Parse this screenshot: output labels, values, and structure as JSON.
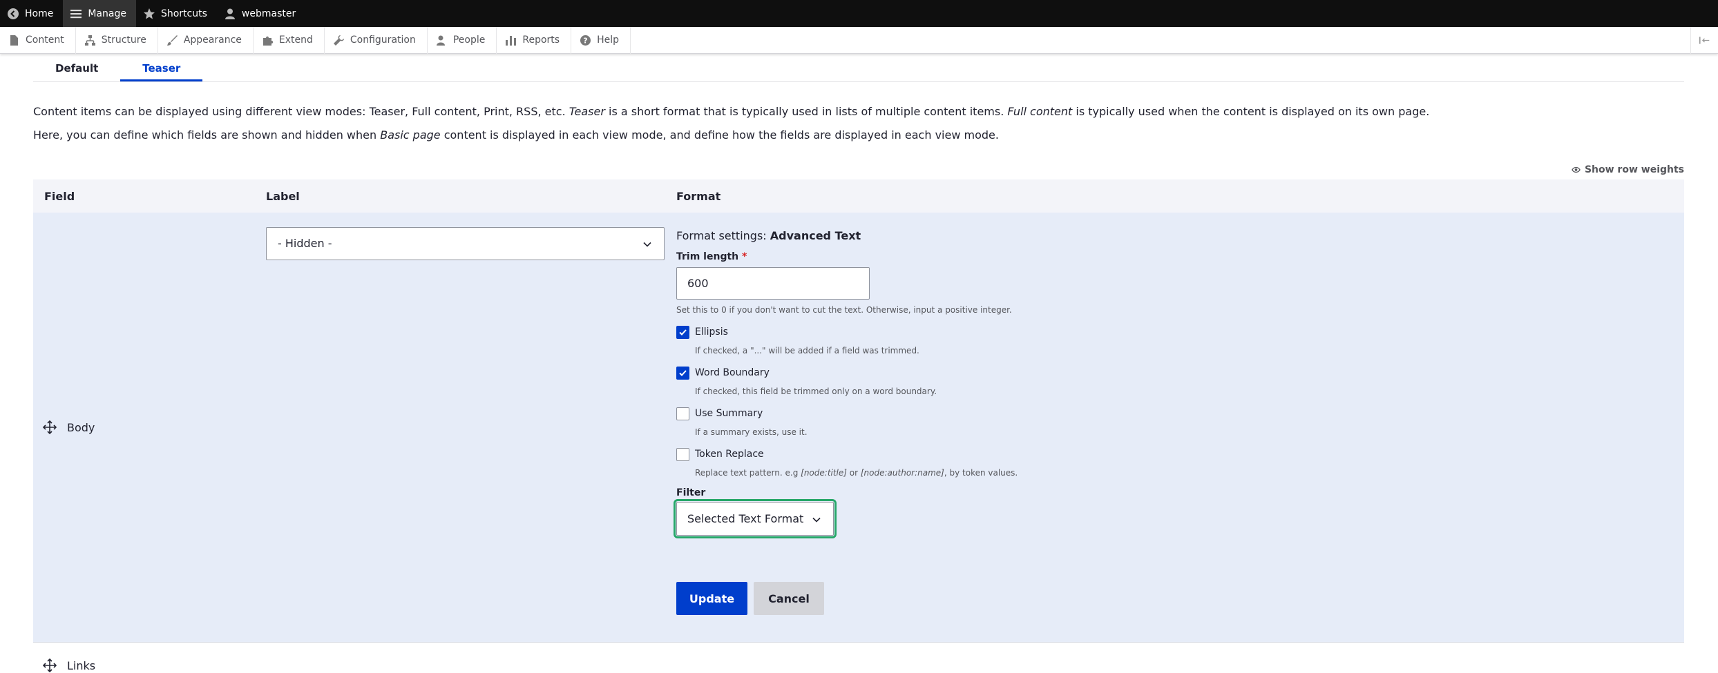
{
  "toolbar": {
    "home": "Home",
    "manage": "Manage",
    "shortcuts": "Shortcuts",
    "user": "webmaster"
  },
  "tray": {
    "items": [
      "Content",
      "Structure",
      "Appearance",
      "Extend",
      "Configuration",
      "People",
      "Reports",
      "Help"
    ]
  },
  "tabs": [
    "Default",
    "Teaser"
  ],
  "description": {
    "line1_a": "Content items can be displayed using different view modes: Teaser, Full content, Print, RSS, etc. ",
    "line1_em1": "Teaser",
    "line1_b": " is a short format that is typically used in lists of multiple content items. ",
    "line1_em2": "Full content",
    "line1_c": " is typically used when the content is displayed on its own page.",
    "line2_a": "Here, you can define which fields are shown and hidden when ",
    "line2_em": "Basic page",
    "line2_b": " content is displayed in each view mode, and define how the fields are displayed in each view mode."
  },
  "show_row_weights": "Show row weights",
  "table": {
    "headers": {
      "field": "Field",
      "label": "Label",
      "format": "Format"
    },
    "rows": [
      {
        "field": "Body",
        "label_select": "- Hidden -"
      },
      {
        "field": "Links"
      }
    ]
  },
  "format_settings": {
    "prefix": "Format settings: ",
    "name": "Advanced Text",
    "trim_label": "Trim length",
    "required_mark": "*",
    "trim_value": "600",
    "trim_hint": "Set this to 0 if you don't want to cut the text. Otherwise, input a positive integer.",
    "options": [
      {
        "label": "Ellipsis",
        "checked": true,
        "hint": "If checked, a \"...\" will be added if a field was trimmed."
      },
      {
        "label": "Word Boundary",
        "checked": true,
        "hint": "If checked, this field be trimmed only on a word boundary."
      },
      {
        "label": "Use Summary",
        "checked": false,
        "hint": "If a summary exists, use it."
      },
      {
        "label": "Token Replace",
        "checked": false,
        "hint_a": "Replace text pattern. e.g ",
        "hint_em1": "[node:title]",
        "hint_b": " or ",
        "hint_em2": "[node:author:name]",
        "hint_c": ", by token values."
      }
    ],
    "filter_label": "Filter",
    "filter_value": "Selected Text Format",
    "update": "Update",
    "cancel": "Cancel"
  },
  "colors": {
    "accent": "#003ecc",
    "focus": "#26a769",
    "toolbar": "#0f0f0f",
    "row_bg": "#e6ecf8"
  }
}
